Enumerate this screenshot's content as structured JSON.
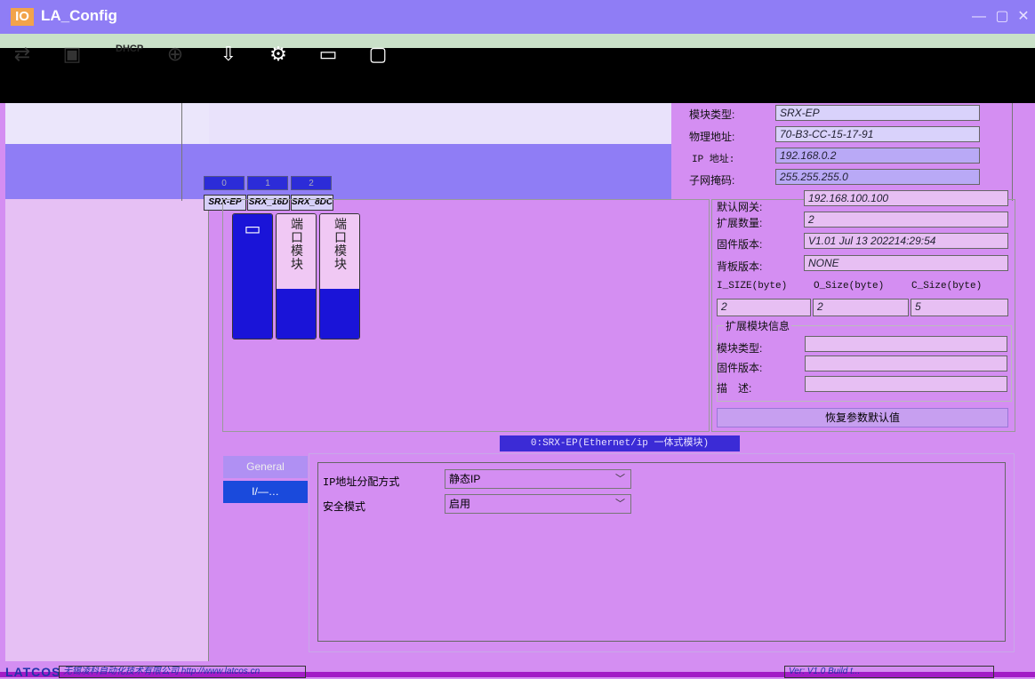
{
  "window": {
    "logo": "IO",
    "title": "LA_Config",
    "minimize_icon": "minimize-icon",
    "maximize_icon": "maximize-icon",
    "close_icon": "close-icon"
  },
  "toolbar": {
    "dhcp_label": "DHCP",
    "icons": [
      "scan-icon",
      "device-icon",
      "dhcp-icon",
      "globe-icon",
      "download-icon",
      "gear-icon",
      "file-icon",
      "info-icon"
    ]
  },
  "slots": {
    "headers": [
      "0",
      "1",
      "2"
    ],
    "names": [
      "SRX-EP",
      "SRX_16D",
      "SRX_8DC"
    ]
  },
  "modules": {
    "text_1": "端口模块",
    "text_2": "端口模块"
  },
  "info": {
    "module_type_label": "模块类型:",
    "module_type_value": "SRX-EP",
    "mac_label": "物理地址:",
    "mac_value": "70-B3-CC-15-17-91",
    "ip_label": "IP 地址:",
    "ip_value": "192.168.0.2",
    "mask_label": "子网掩码:",
    "mask_value": "255.255.255.0",
    "gateway_label": "默认网关:",
    "gateway_value": "192.168.100.100",
    "ext_count_label": "扩展数量:",
    "ext_count_value": "2",
    "fw_label": "固件版本:",
    "fw_value": "V1.01 Jul 13 202214:29:54",
    "bp_label": "背板版本:",
    "bp_value": "NONE",
    "i_size_label": "I_SIZE(byte)",
    "o_size_label": "O_Size(byte)",
    "c_size_label": "C_Size(byte)",
    "i_size_value": "2",
    "o_size_value": "2",
    "c_size_value": "5",
    "ext_group_title": "扩展模块信息",
    "ext_type_label": "模块类型:",
    "ext_fw_label": "固件版本:",
    "ext_desc_label": "描　述:",
    "restore_button": "恢复参数默认值"
  },
  "ribbon": "0:SRX-EP(Ethernet/ip 一体式模块)",
  "tabs": {
    "general": "General",
    "io": "I/—…"
  },
  "config": {
    "ip_mode_label": "IP地址分配方式",
    "ip_mode_value": "静态IP",
    "safe_mode_label": "安全模式",
    "safe_mode_value": "启用"
  },
  "footer": {
    "logo": "LATCOS",
    "company": "无锡凌科自动化技术有限公司 http://www.latcos.cn",
    "version": "Ver: V1.0 Build t..."
  }
}
